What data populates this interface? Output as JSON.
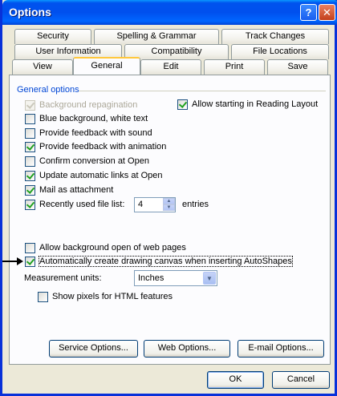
{
  "window": {
    "title": "Options"
  },
  "titlebar_buttons": {
    "help": "?",
    "close": "✕"
  },
  "tabs": {
    "row1": [
      "Security",
      "Spelling & Grammar",
      "Track Changes"
    ],
    "row2": [
      "User Information",
      "Compatibility",
      "File Locations"
    ],
    "row3": [
      "View",
      "General",
      "Edit",
      "Print",
      "Save"
    ],
    "active": "General"
  },
  "general": {
    "group_title": "General options",
    "options": {
      "background_repagination": {
        "label": "Background repagination",
        "checked": true,
        "enabled": false
      },
      "blue_background": {
        "label": "Blue background, white text",
        "checked": false
      },
      "feedback_sound": {
        "label": "Provide feedback with sound",
        "checked": false
      },
      "feedback_animation": {
        "label": "Provide feedback with animation",
        "checked": true
      },
      "confirm_conversion": {
        "label": "Confirm conversion at Open",
        "checked": false
      },
      "update_links": {
        "label": "Update automatic links at Open",
        "checked": true
      },
      "mail_attachment": {
        "label": "Mail as attachment",
        "checked": true
      },
      "recent_files": {
        "label": "Recently used file list:",
        "checked": true
      },
      "reading_layout": {
        "label": "Allow starting in Reading Layout",
        "checked": true
      },
      "background_open_web": {
        "label": "Allow background open of web pages",
        "checked": false
      },
      "drawing_canvas": {
        "label": "Automatically create drawing canvas when inserting AutoShapes",
        "checked": true
      },
      "show_pixels": {
        "label": "Show pixels for HTML features",
        "checked": false
      }
    },
    "recent_files_count": "4",
    "entries_label": "entries",
    "measurement_label": "Measurement units:",
    "measurement_value": "Inches"
  },
  "buttons": {
    "service_options": "Service Options...",
    "web_options": "Web Options...",
    "email_options": "E-mail Options...",
    "ok": "OK",
    "cancel": "Cancel"
  }
}
